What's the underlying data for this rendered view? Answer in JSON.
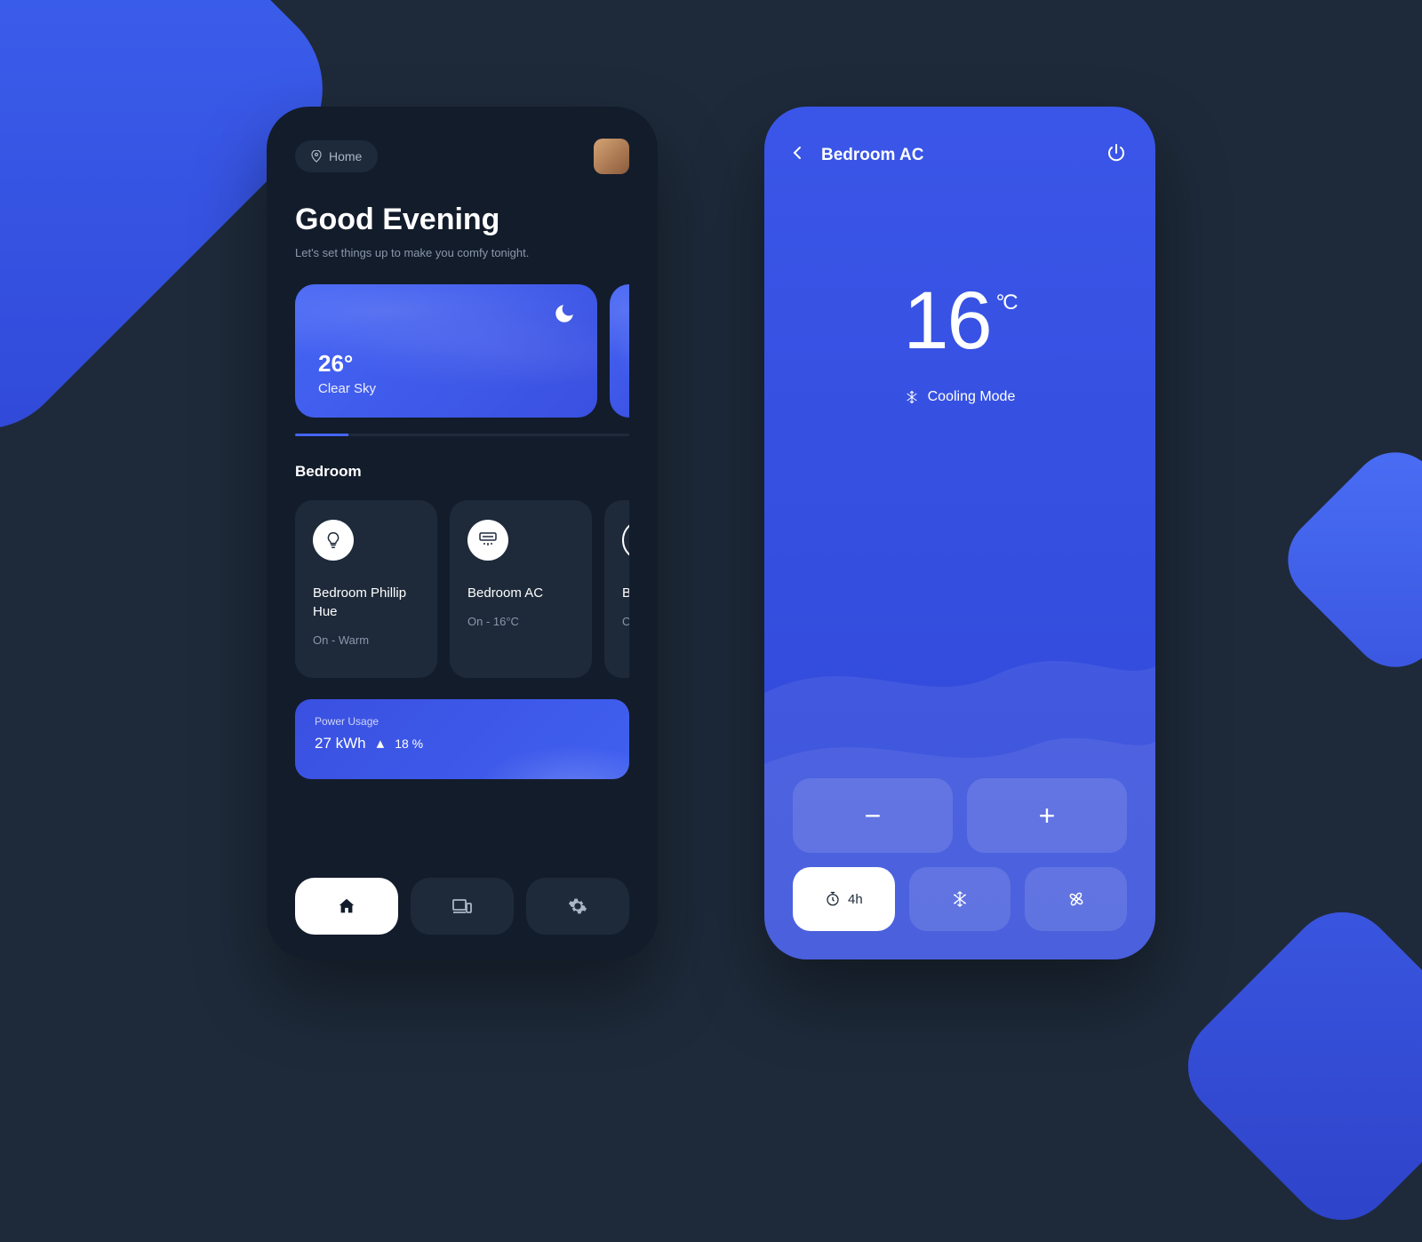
{
  "dashboard": {
    "location": "Home",
    "greeting": "Good Evening",
    "subtitle": "Let's set things up to make you comfy tonight.",
    "weather": {
      "temp": "26°",
      "condition": "Clear Sky"
    },
    "section": "Bedroom",
    "devices": [
      {
        "name": "Bedroom Phillip Hue",
        "status": "On - Warm"
      },
      {
        "name": "Bedroom AC",
        "status": "On - 16°C"
      },
      {
        "name": "Bedroom Lamp",
        "status": "Off"
      }
    ],
    "power": {
      "label": "Power Usage",
      "value": "27 kWh",
      "trend": "18 %"
    }
  },
  "ac": {
    "title": "Bedroom AC",
    "temp": "16",
    "unit": "°C",
    "mode": "Cooling Mode",
    "timer": "4h"
  }
}
